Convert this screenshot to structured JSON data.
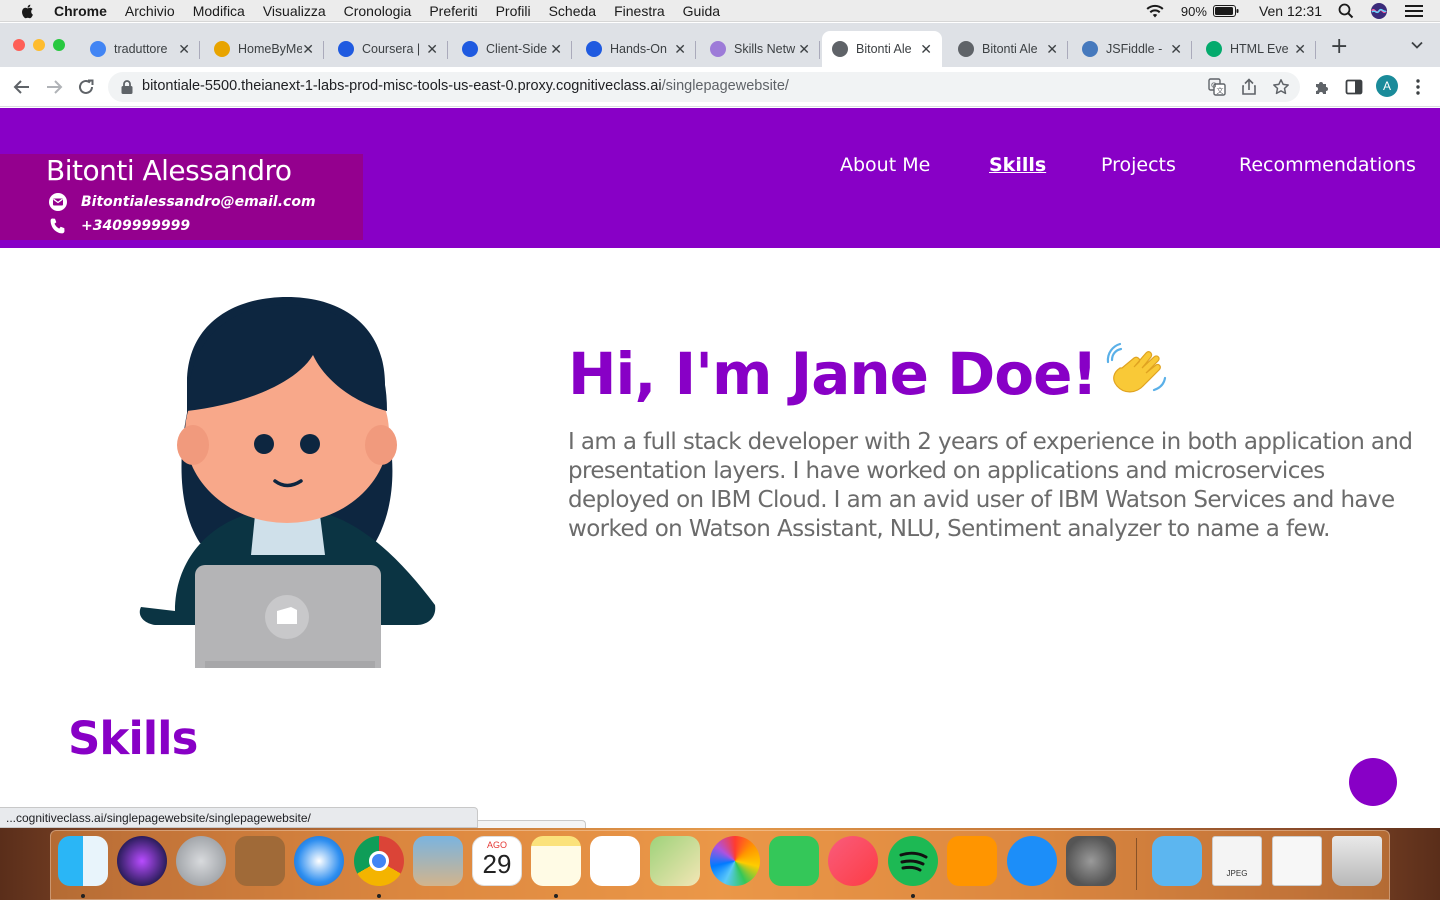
{
  "menubar": {
    "app_name": "Chrome",
    "items": [
      "Archivio",
      "Modifica",
      "Visualizza",
      "Cronologia",
      "Preferiti",
      "Profili",
      "Scheda",
      "Finestra",
      "Guida"
    ],
    "battery": "90%",
    "clock": "Ven 12:31"
  },
  "tabs": [
    {
      "title": "traduttore",
      "icon": "google-icon",
      "color": "#4285f4"
    },
    {
      "title": "HomeByMe",
      "icon": "homebyme-icon",
      "color": "#e8a400"
    },
    {
      "title": "Coursera |",
      "icon": "coursera-icon",
      "color": "#1f5ae0"
    },
    {
      "title": "Client-Side",
      "icon": "coursera-icon",
      "color": "#1f5ae0"
    },
    {
      "title": "Hands-On",
      "icon": "coursera-icon",
      "color": "#1f5ae0"
    },
    {
      "title": "Skills Netw",
      "icon": "skills-network-icon",
      "color": "#9d7bd8"
    },
    {
      "title": "Bitonti Ale",
      "icon": "globe-icon",
      "color": "#5f6368"
    },
    {
      "title": "Bitonti Ale",
      "icon": "globe-icon",
      "color": "#5f6368"
    },
    {
      "title": "JSFiddle -",
      "icon": "jsfiddle-icon",
      "color": "#4679bd"
    },
    {
      "title": "HTML Eve",
      "icon": "w3schools-icon",
      "color": "#04aa6d"
    }
  ],
  "active_tab_index": 6,
  "address_bar": {
    "host": "bitontiale-5500.theianext-1-labs-prod-misc-tools-us-east-0.proxy.cognitiveclass.ai",
    "path": "/singlepagewebsite/"
  },
  "profile_initial": "A",
  "site": {
    "name": "Bitonti Alessandro",
    "email": "Bitontialessandro@email.com",
    "phone": "+3409999999",
    "nav": [
      "About Me",
      "Skills",
      "Projects",
      "Recommendations"
    ],
    "active_nav_index": 1,
    "hero_title": "Hi, I'm Jane Doe!",
    "hero_text": "I am a full stack developer with 2 years of experience in both application and presentation layers. I have worked on applications and microservices deployed on IBM Cloud. I am an avid user of IBM Watson Services and have worked on Watson Assistant, NLU, Sentiment analyzer to name a few.",
    "skills_heading": "Skills"
  },
  "status_url": "...cognitiveclass.ai/singlepagewebsite/singlepagewebsite/",
  "dock": {
    "calendar_month": "AGO",
    "calendar_day": "29",
    "preview_label": "JPEG",
    "apps": [
      "finder-icon",
      "siri-icon",
      "launchpad-icon",
      "contacts-icon",
      "safari-icon",
      "chrome-icon",
      "preview-icon",
      "calendar-icon",
      "notes-icon",
      "reminders-icon",
      "maps-icon",
      "photos-icon",
      "facetime-icon",
      "music-icon",
      "spotify-icon",
      "books-icon",
      "app-store-icon",
      "system-preferences-icon",
      "downloads-folder-icon",
      "jpeg-file-icon",
      "screenshot-file-icon",
      "trash-icon"
    ]
  },
  "colors": {
    "brand_purple": "#8800c6",
    "contact_magenta": "#94008e",
    "body_text_gray": "#6b6b6b"
  }
}
